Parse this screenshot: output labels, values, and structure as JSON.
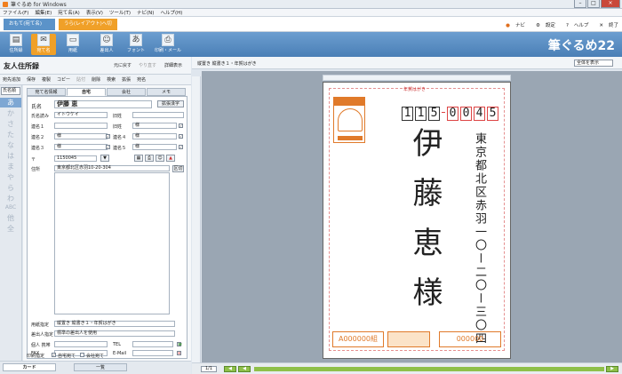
{
  "window": {
    "title": "筆ぐるめ for Windows"
  },
  "menu": [
    "ファイル(F)",
    "編集(E)",
    "宛て名(A)",
    "表示(V)",
    "ツール(T)",
    "ナビ(N)",
    "ヘルプ(H)"
  ],
  "modes": {
    "omote": "おもて(宛て名)",
    "ura": "うら(レイアウト)へ切替"
  },
  "top_links": [
    "ナビ",
    "設定",
    "ヘルプ",
    "終了"
  ],
  "toolbar": [
    "住所録",
    "宛て名",
    "用紙",
    "差出人",
    "フォント",
    "印刷・メール"
  ],
  "brand": "筆ぐるめ22",
  "left_header": {
    "title": "友人住所録",
    "buttons": [
      "元に戻す",
      "やり直す",
      "詳細表示"
    ]
  },
  "subtools": [
    "宛先追加",
    "保存",
    "複製",
    "コピー",
    "貼付",
    "削除",
    "検索",
    "拡張",
    "宛名"
  ],
  "kana": {
    "select": "氏名順",
    "items": [
      "あ",
      "か",
      "さ",
      "た",
      "な",
      "は",
      "ま",
      "や",
      "ら",
      "わ",
      "ABC",
      "他",
      "全"
    ]
  },
  "form": {
    "tabs": [
      "宛て名情報",
      "自宅",
      "会社",
      "メモ"
    ],
    "name_label": "氏名",
    "name_value": "伊藤 恵",
    "kanji_btn": "拡張漢字",
    "yomi_label": "氏名読み",
    "yomi_value": "イトウケイ",
    "old_label": "旧姓",
    "rensei": [
      "連名１",
      "連名２",
      "連名３",
      "連名４",
      "連名５"
    ],
    "sama": "様",
    "zip_label": "〒",
    "zip_value": "1150045",
    "addr_label": "住所",
    "addr_value": "東京都北区赤羽10-20-304",
    "addr_btn": "区切",
    "paper_label": "用紙指定",
    "paper_value": "縦置き 縦書き１・年賀はがき",
    "sender_label": "差出人指定",
    "sender_value": "標準の差出人を使用",
    "tel_personal": "個人 携帯",
    "tel": "TEL",
    "fax": "FAX",
    "email": "E-Mail",
    "print_label": "印刷指定",
    "print_home": "自宅宛て",
    "print_company": "会社宛て"
  },
  "bottom_tabs": [
    "カード",
    "一覧"
  ],
  "preview": {
    "label": "縦置き 縦書き１・年賀はがき",
    "zoom": "全体を表示",
    "postmark": "年賀はがき",
    "zip_digits": [
      "1",
      "1",
      "5",
      "0",
      "0",
      "4",
      "5"
    ],
    "address": "東京都北区赤羽一〇ー二〇ー三〇四",
    "name": "伊藤恵",
    "honorific": "様",
    "lotto_a": "A000000組",
    "lotto_b": "000000"
  },
  "pagebar": {
    "page": "1/1"
  }
}
